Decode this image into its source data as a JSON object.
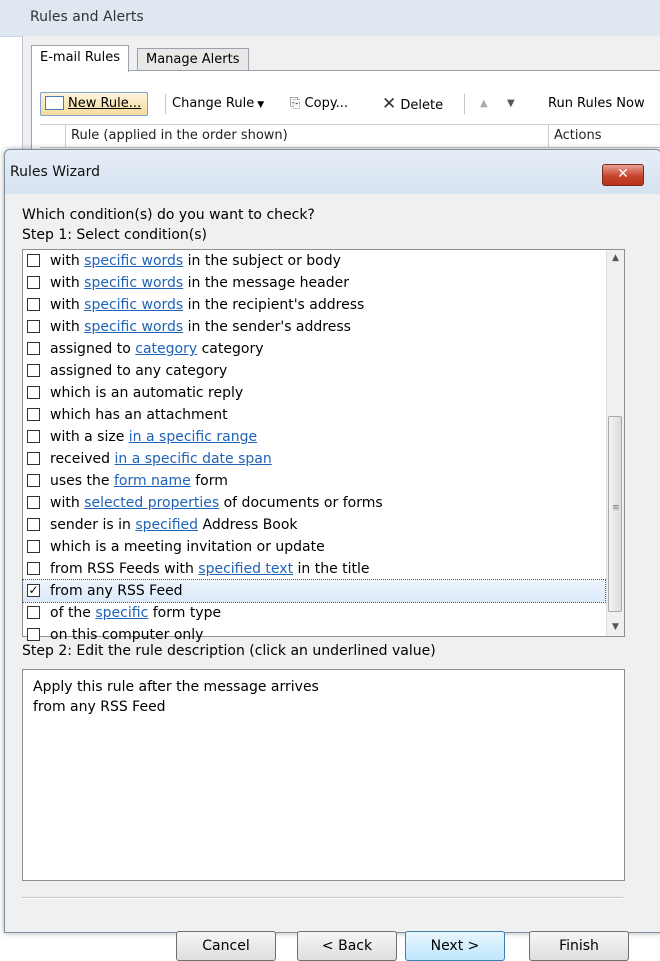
{
  "background_window": {
    "title": "Rules and Alerts",
    "tabs": [
      "E-mail Rules",
      "Manage Alerts"
    ],
    "toolbar": {
      "new_rule": "New Rule...",
      "change_rule": "Change Rule",
      "copy": "Copy...",
      "delete": "Delete",
      "run_rules_now": "Run Rules Now"
    },
    "list_columns": [
      "Rule (applied in the order shown)",
      "Actions"
    ]
  },
  "wizard": {
    "title": "Rules Wizard",
    "close_glyph": "✕",
    "question": "Which condition(s) do you want to check?",
    "step1_label": "Step 1: Select condition(s)",
    "conditions": [
      {
        "checked": false,
        "parts": [
          "with ",
          {
            "link": "specific words"
          },
          " in the subject or body"
        ]
      },
      {
        "checked": false,
        "parts": [
          "with ",
          {
            "link": "specific words"
          },
          " in the message header"
        ]
      },
      {
        "checked": false,
        "parts": [
          "with ",
          {
            "link": "specific words"
          },
          " in the recipient's address"
        ]
      },
      {
        "checked": false,
        "parts": [
          "with ",
          {
            "link": "specific words"
          },
          " in the sender's address"
        ]
      },
      {
        "checked": false,
        "parts": [
          "assigned to ",
          {
            "link": "category"
          },
          " category"
        ]
      },
      {
        "checked": false,
        "parts": [
          "assigned to any category"
        ]
      },
      {
        "checked": false,
        "parts": [
          "which is an automatic reply"
        ]
      },
      {
        "checked": false,
        "parts": [
          "which has an attachment"
        ]
      },
      {
        "checked": false,
        "parts": [
          "with a size ",
          {
            "link": "in a specific range"
          }
        ]
      },
      {
        "checked": false,
        "parts": [
          "received ",
          {
            "link": "in a specific date span"
          }
        ]
      },
      {
        "checked": false,
        "parts": [
          "uses the ",
          {
            "link": "form name"
          },
          " form"
        ]
      },
      {
        "checked": false,
        "parts": [
          "with ",
          {
            "link": "selected properties"
          },
          " of documents or forms"
        ]
      },
      {
        "checked": false,
        "parts": [
          "sender is in ",
          {
            "link": "specified"
          },
          " Address Book"
        ]
      },
      {
        "checked": false,
        "parts": [
          "which is a meeting invitation or update"
        ]
      },
      {
        "checked": false,
        "parts": [
          "from RSS Feeds with ",
          {
            "link": "specified text"
          },
          " in the title"
        ]
      },
      {
        "checked": true,
        "selected": true,
        "parts": [
          "from any RSS Feed"
        ]
      },
      {
        "checked": false,
        "parts": [
          "of the ",
          {
            "link": "specific"
          },
          " form type"
        ]
      },
      {
        "checked": false,
        "parts": [
          "on this computer only"
        ]
      }
    ],
    "step2_label": "Step 2: Edit the rule description (click an underlined value)",
    "description_lines": [
      "Apply this rule after the message arrives",
      "from any RSS Feed"
    ],
    "buttons": {
      "cancel": "Cancel",
      "back": "< Back",
      "next": "Next >",
      "finish": "Finish"
    }
  }
}
